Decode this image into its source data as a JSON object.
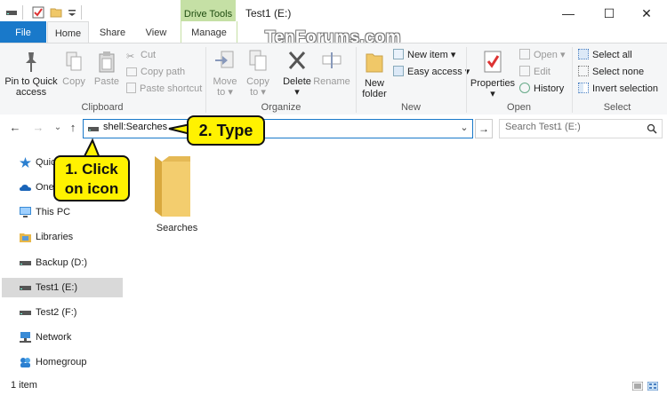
{
  "titlebar": {
    "title": "Test1 (E:)",
    "context_tab": "Drive Tools",
    "minimize_glyph": "—",
    "maximize_glyph": "☐",
    "close_glyph": "✕"
  },
  "tabs": [
    {
      "label": "File"
    },
    {
      "label": "Home"
    },
    {
      "label": "Share"
    },
    {
      "label": "View"
    },
    {
      "label": "Manage"
    }
  ],
  "watermark": "TenForums.com",
  "ribbon": {
    "clipboard": {
      "label": "Clipboard",
      "pin": "Pin to Quick",
      "pin2": "access",
      "copy": "Copy",
      "paste": "Paste",
      "cut": "Cut",
      "copy_path": "Copy path",
      "paste_shortcut": "Paste shortcut"
    },
    "organize": {
      "label": "Organize",
      "move": "Move",
      "move2": "to ▾",
      "copy": "Copy",
      "copy2": "to ▾",
      "delete": "Delete",
      "delete2": "▾",
      "rename": "Rename"
    },
    "new": {
      "label": "New",
      "new_folder": "New",
      "new_folder2": "folder",
      "new_item": "New item ▾",
      "easy_access": "Easy access ▾"
    },
    "open": {
      "label": "Open",
      "properties": "Properties",
      "properties2": "▾",
      "open": "Open ▾",
      "edit": "Edit",
      "history": "History"
    },
    "select": {
      "label": "Select",
      "select_all": "Select all",
      "select_none": "Select none",
      "invert": "Invert selection"
    }
  },
  "address": {
    "text": "shell:Searches",
    "search_placeholder": "Search Test1 (E:)",
    "back": "←",
    "forward": "→",
    "recent": "⌄",
    "up": "↑",
    "dropdown": "⌄",
    "go": "→"
  },
  "sidebar": [
    {
      "label": "Quic"
    },
    {
      "label": "One"
    },
    {
      "label": "This PC"
    },
    {
      "label": "Libraries"
    },
    {
      "label": "Backup (D:)"
    },
    {
      "label": "Test1 (E:)"
    },
    {
      "label": "Test2 (F:)"
    },
    {
      "label": "Network"
    },
    {
      "label": "Homegroup"
    }
  ],
  "content": {
    "items": [
      {
        "name": "Searches"
      }
    ]
  },
  "status": {
    "text": "1 item"
  },
  "callouts": {
    "type": "2. Type",
    "click1": "1. Click",
    "click2": "on icon"
  },
  "colors": {
    "accent": "#1979ca",
    "callout": "#fff200",
    "context_tab": "#c5e0a5",
    "folder": "#f0c868"
  }
}
